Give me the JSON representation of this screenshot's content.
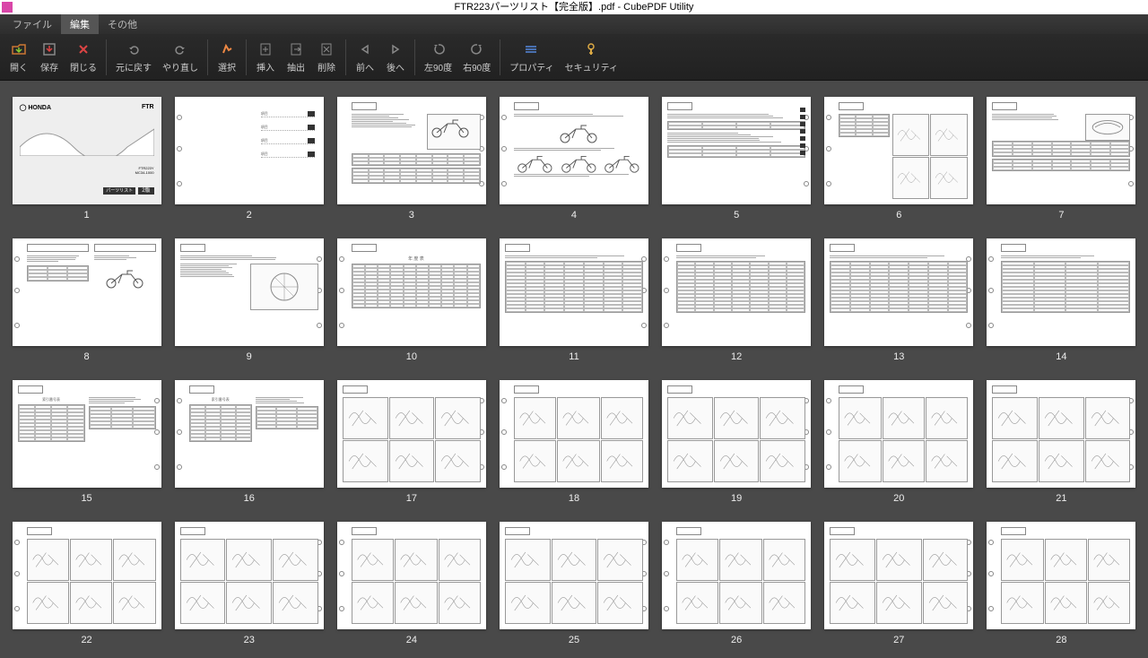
{
  "window": {
    "title": "FTR223パーツリスト【完全版】.pdf - CubePDF Utility"
  },
  "menu": {
    "file": "ファイル",
    "edit": "編集",
    "other": "その他"
  },
  "toolbar": {
    "open": "開く",
    "save": "保存",
    "close": "閉じる",
    "undo": "元に戻す",
    "redo": "やり直し",
    "select": "選択",
    "insert": "挿入",
    "extract": "抽出",
    "remove": "削除",
    "back": "前へ",
    "forward": "後へ",
    "rotate_left": "左90度",
    "rotate_right": "右90度",
    "property": "プロパティ",
    "security": "セキュリティ"
  },
  "pages": [
    {
      "num": "1"
    },
    {
      "num": "2"
    },
    {
      "num": "3"
    },
    {
      "num": "4"
    },
    {
      "num": "5"
    },
    {
      "num": "6"
    },
    {
      "num": "7"
    },
    {
      "num": "8"
    },
    {
      "num": "9"
    },
    {
      "num": "10"
    },
    {
      "num": "11"
    },
    {
      "num": "12"
    },
    {
      "num": "13"
    },
    {
      "num": "14"
    },
    {
      "num": "15"
    },
    {
      "num": "16"
    },
    {
      "num": "17"
    },
    {
      "num": "18"
    },
    {
      "num": "19"
    },
    {
      "num": "20"
    },
    {
      "num": "21"
    },
    {
      "num": "22"
    },
    {
      "num": "23"
    },
    {
      "num": "24"
    },
    {
      "num": "25"
    },
    {
      "num": "26"
    },
    {
      "num": "27"
    },
    {
      "num": "28"
    }
  ],
  "cover": {
    "brand": "HONDA",
    "model": "FTR",
    "code": "FTR223Y",
    "sub": "MC34-1000",
    "label": "パーツリスト",
    "badge": "2"
  }
}
